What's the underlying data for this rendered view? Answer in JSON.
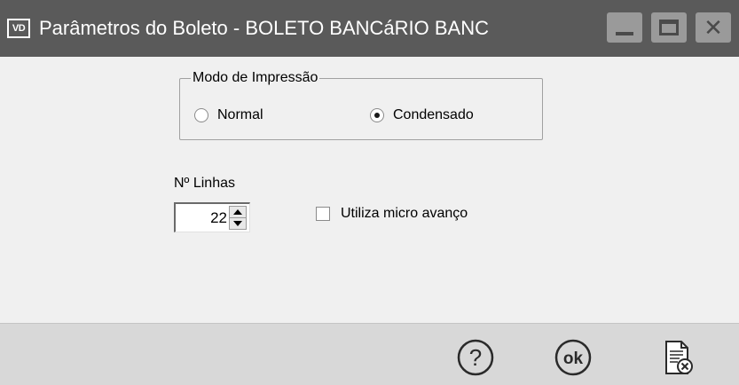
{
  "window": {
    "app_icon_text": "VD",
    "title": "Parâmetros do Boleto - BOLETO BANCáRIO BANC"
  },
  "print_mode": {
    "legend": "Modo de Impressão",
    "options": [
      {
        "label": "Normal",
        "selected": false
      },
      {
        "label": "Condensado",
        "selected": true
      }
    ]
  },
  "lines": {
    "label": "Nº Linhas",
    "value": "22"
  },
  "micro_advance": {
    "label": "Utiliza micro avanço",
    "checked": false
  },
  "footer": {
    "buttons": [
      {
        "icon": "help-icon"
      },
      {
        "icon": "ok-icon"
      },
      {
        "icon": "cancel-document-icon"
      }
    ]
  },
  "colors": {
    "titlebar": "#5a5a5a",
    "background": "#f0f0f0",
    "footer": "#d8d8d8"
  }
}
